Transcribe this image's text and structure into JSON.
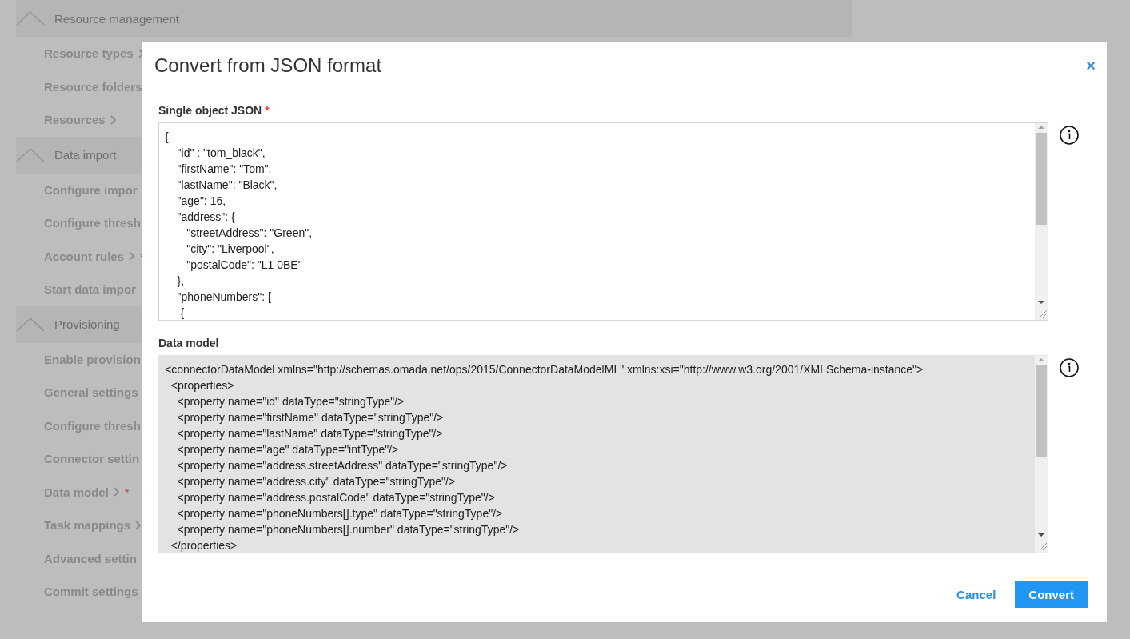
{
  "sidebar": {
    "sections": [
      {
        "title": "Resource management",
        "expanded": true,
        "items": [
          {
            "label": "Resource types",
            "chevron": true
          },
          {
            "label": "Resource folders",
            "chevron": false
          },
          {
            "label": "Resources",
            "chevron": true
          }
        ]
      },
      {
        "title": "Data import",
        "expanded": true,
        "items": [
          {
            "label": "Configure impor",
            "chevron": false
          },
          {
            "label": "Configure thresh",
            "chevron": false
          },
          {
            "label": "Account rules",
            "chevron": true,
            "required_mark": "*"
          },
          {
            "label": "Start data impor",
            "chevron": false
          }
        ]
      },
      {
        "title": "Provisioning",
        "expanded": true,
        "items": [
          {
            "label": "Enable provision",
            "chevron": false
          },
          {
            "label": "General settings",
            "chevron": false
          },
          {
            "label": "Configure thresh",
            "chevron": false
          },
          {
            "label": "Connector settin",
            "chevron": false
          },
          {
            "label": "Data model",
            "chevron": true,
            "required_mark": "*"
          },
          {
            "label": "Task mappings",
            "chevron": true
          },
          {
            "label": "Advanced settin",
            "chevron": false
          },
          {
            "label": "Commit settings",
            "chevron": false
          }
        ]
      }
    ]
  },
  "dialog": {
    "title": "Convert from JSON format",
    "close": "×",
    "fields": [
      {
        "label": "Single object JSON",
        "required_mark": "*",
        "readonly": false,
        "value": "{\n    \"id\" : \"tom_black\",\n    \"firstName\": \"Tom\",\n    \"lastName\": \"Black\",\n    \"age\": 16,\n    \"address\": {\n       \"streetAddress\": \"Green\",\n       \"city\": \"Liverpool\",\n       \"postalCode\": \"L1 0BE\"\n    },\n    \"phoneNumbers\": [\n     {"
      },
      {
        "label": "Data model",
        "readonly": true,
        "value": "<connectorDataModel xmlns=\"http://schemas.omada.net/ops/2015/ConnectorDataModelML\" xmlns:xsi=\"http://www.w3.org/2001/XMLSchema-instance\">\n  <properties>\n    <property name=\"id\" dataType=\"stringType\"/>\n    <property name=\"firstName\" dataType=\"stringType\"/>\n    <property name=\"lastName\" dataType=\"stringType\"/>\n    <property name=\"age\" dataType=\"intType\"/>\n    <property name=\"address.streetAddress\" dataType=\"stringType\"/>\n    <property name=\"address.city\" dataType=\"stringType\"/>\n    <property name=\"address.postalCode\" dataType=\"stringType\"/>\n    <property name=\"phoneNumbers[].type\" dataType=\"stringType\"/>\n    <property name=\"phoneNumbers[].number\" dataType=\"stringType\"/>\n  </properties>"
      }
    ],
    "buttons": [
      {
        "label": "Cancel",
        "kind": "link"
      },
      {
        "label": "Convert",
        "kind": "primary"
      }
    ]
  }
}
